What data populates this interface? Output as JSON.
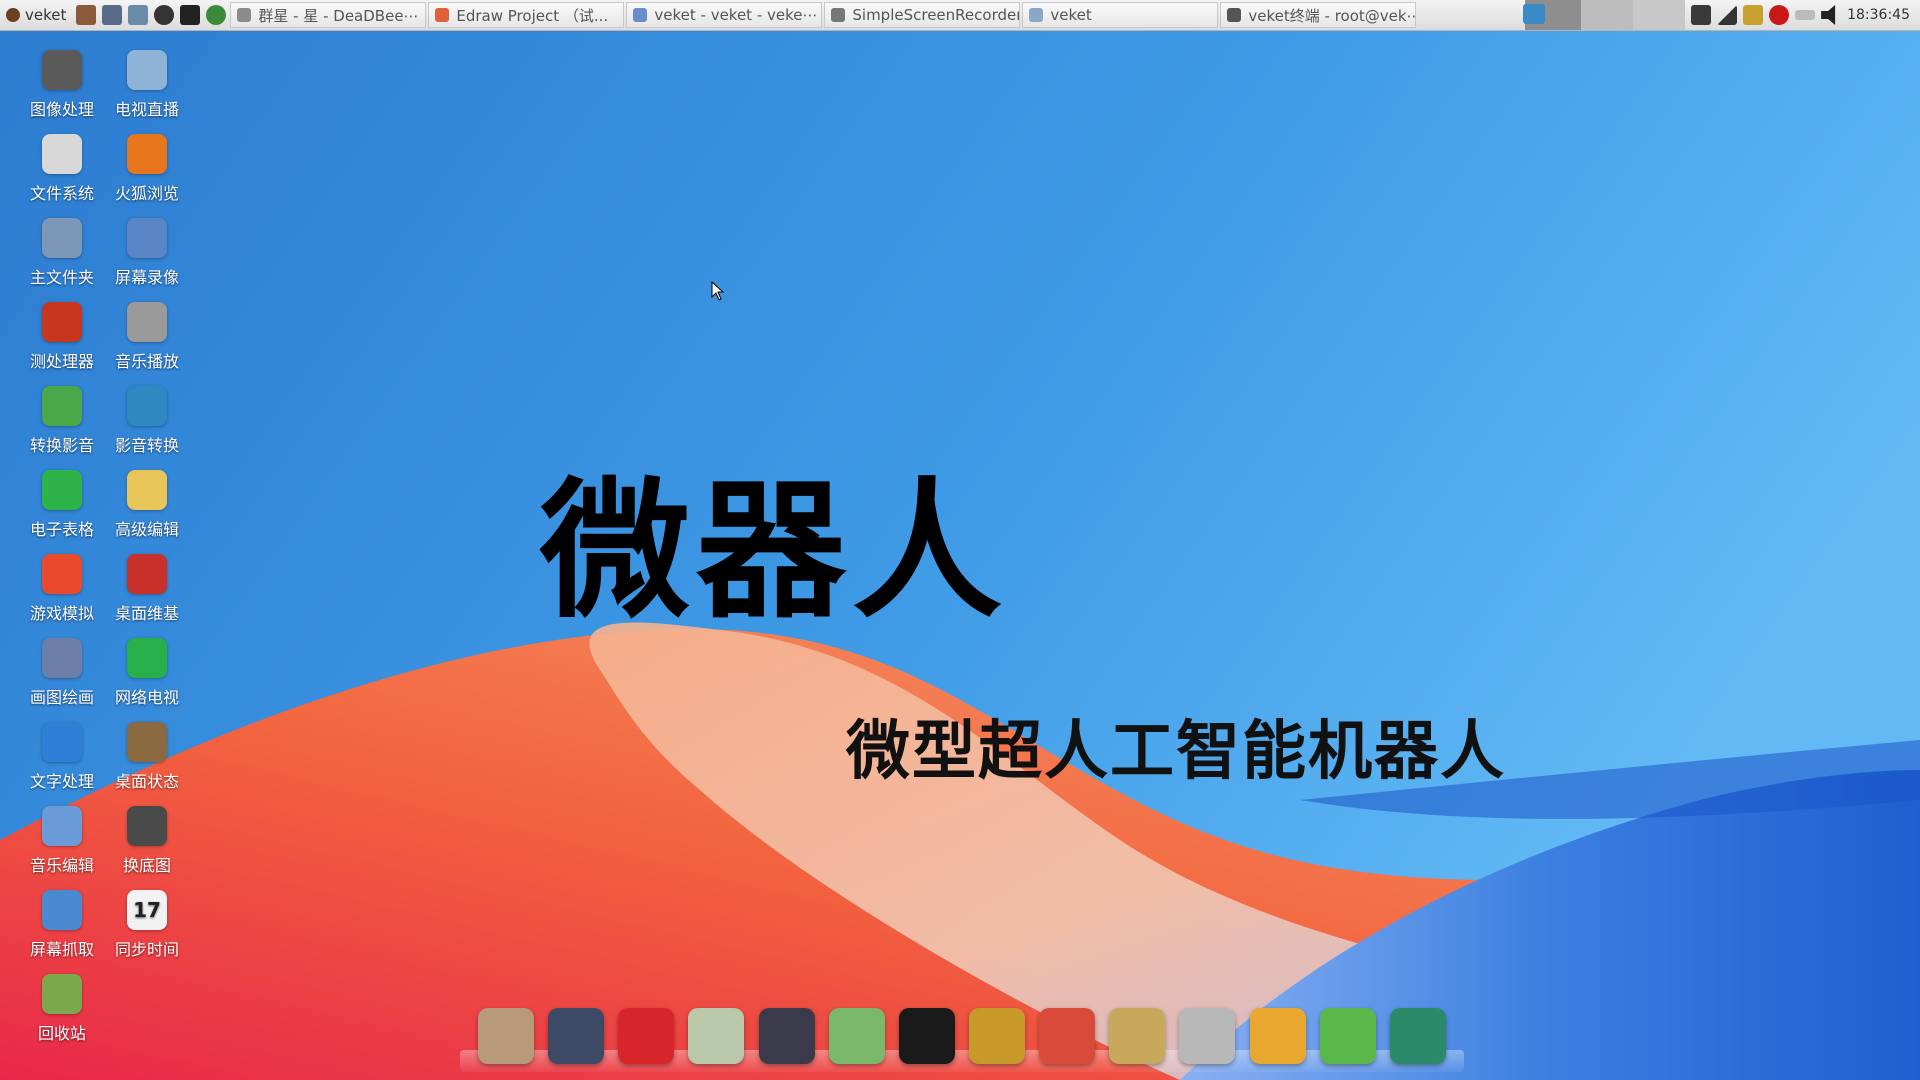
{
  "taskbar": {
    "start_label": "veket",
    "tasks": [
      {
        "label": "群星 - 星 - DeaDBee⋯",
        "icon": "music-player-icon",
        "color": "#8b8b8b"
      },
      {
        "label": "Edraw Project （试...",
        "icon": "edraw-icon",
        "color": "#e0603c"
      },
      {
        "label": "veket - veket - veke⋯",
        "icon": "browser-icon",
        "color": "#6a8cc8"
      },
      {
        "label": "SimpleScreenRecorder",
        "icon": "recorder-icon",
        "color": "#777777"
      },
      {
        "label": "veket",
        "icon": "folder-icon",
        "color": "#8aa6c8"
      },
      {
        "label": "veket终端 - root@vek⋯",
        "icon": "terminal-icon",
        "color": "#555555"
      }
    ],
    "clock": "18:36:45"
  },
  "desktop_icons": [
    {
      "label": "图像处理",
      "icon": "gimp-icon",
      "color": "#5a5a5a"
    },
    {
      "label": "电视直播",
      "icon": "tv-icon",
      "color": "#8fb3d6"
    },
    {
      "label": "文件系统",
      "icon": "drive-icon",
      "color": "#d8d8d8"
    },
    {
      "label": "火狐浏览",
      "icon": "firefox-icon",
      "color": "#e8761c"
    },
    {
      "label": "主文件夹",
      "icon": "home-folder-icon",
      "color": "#7d97b8"
    },
    {
      "label": "屏幕录像",
      "icon": "screen-record-icon",
      "color": "#5a86c8"
    },
    {
      "label": "测处理器",
      "icon": "cpu-test-icon",
      "color": "#c8361f"
    },
    {
      "label": "音乐播放",
      "icon": "music-play-icon",
      "color": "#9a9a9a"
    },
    {
      "label": "转换影音",
      "icon": "convert-media-icon",
      "color": "#4aa84a"
    },
    {
      "label": "影音转换",
      "icon": "media-convert-icon",
      "color": "#2f88c0"
    },
    {
      "label": "电子表格",
      "icon": "spreadsheet-icon",
      "color": "#2db34a"
    },
    {
      "label": "高级编辑",
      "icon": "text-editor-icon",
      "color": "#e8c65a"
    },
    {
      "label": "游戏模拟",
      "icon": "game-emulator-icon",
      "color": "#e94b2a"
    },
    {
      "label": "桌面维基",
      "icon": "desktop-wiki-icon",
      "color": "#c8302a"
    },
    {
      "label": "画图绘画",
      "icon": "paint-icon",
      "color": "#6b7fa8"
    },
    {
      "label": "网络电视",
      "icon": "web-tv-icon",
      "color": "#27b04a"
    },
    {
      "label": "文字处理",
      "icon": "word-processor-icon",
      "color": "#2e7fd6"
    },
    {
      "label": "桌面状态",
      "icon": "desktop-status-icon",
      "color": "#8a6a40"
    },
    {
      "label": "音乐编辑",
      "icon": "audio-edit-icon",
      "color": "#6a9ad8"
    },
    {
      "label": "换底图",
      "icon": "wallpaper-icon",
      "color": "#4a4a4a"
    },
    {
      "label": "屏幕抓取",
      "icon": "screenshot-icon",
      "color": "#4a8ad0"
    },
    {
      "label": "同步时间",
      "icon": "calendar-icon",
      "color": "#f2f2f2"
    },
    {
      "label": "回收站",
      "icon": "trash-icon",
      "color": "#7aa84a"
    }
  ],
  "calendar_day": "17",
  "headline": {
    "main": "微器人",
    "sub": "微型超人工智能机器人"
  },
  "dock": [
    {
      "icon": "file-manager-icon",
      "color": "#b89a7a"
    },
    {
      "icon": "monitor-icon",
      "color": "#3c4a66"
    },
    {
      "icon": "red-creature-icon",
      "color": "#d8262a"
    },
    {
      "icon": "notepad-icon",
      "color": "#b8c8a8"
    },
    {
      "icon": "media-player-icon",
      "color": "#3a3a4a"
    },
    {
      "icon": "users-icon",
      "color": "#7ab86a"
    },
    {
      "icon": "penguin-icon",
      "color": "#1a1a1a"
    },
    {
      "icon": "book-icon",
      "color": "#c89a2a"
    },
    {
      "icon": "presentation-icon",
      "color": "#d84a3a"
    },
    {
      "icon": "palette-icon",
      "color": "#c8a85a"
    },
    {
      "icon": "usb-drive-icon",
      "color": "#b8b8b8"
    },
    {
      "icon": "fortune-icon",
      "color": "#e8a830"
    },
    {
      "icon": "help-icon",
      "color": "#5ab84a"
    },
    {
      "icon": "camera-icon",
      "color": "#2a8a6a"
    }
  ]
}
